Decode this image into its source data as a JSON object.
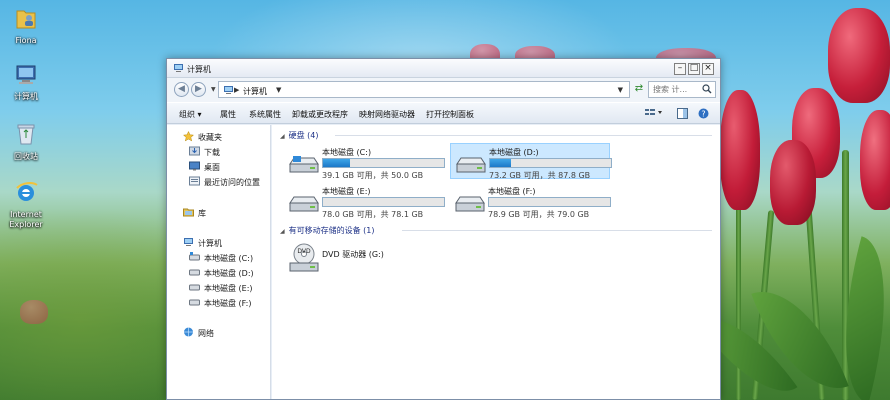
{
  "desktop": {
    "icons": [
      {
        "label": "Fiona"
      },
      {
        "label": "计算机"
      },
      {
        "label": "回收站"
      },
      {
        "label": "Internet Explorer"
      }
    ]
  },
  "window": {
    "title": "计算机",
    "address": {
      "crumb": "计算机"
    },
    "search": {
      "placeholder": "搜索 计..."
    },
    "toolbar": {
      "organize": "组织 ▾",
      "properties": "属性",
      "system_properties": "系统属性",
      "uninstall": "卸载或更改程序",
      "map_drive": "映射网络驱动器",
      "control_panel": "打开控制面板"
    },
    "nav": {
      "favorites": "收藏夹",
      "downloads": "下载",
      "desktop": "桌面",
      "recent": "最近访问的位置",
      "libraries": "库",
      "computer": "计算机",
      "drive_c": "本地磁盘 (C:)",
      "drive_d": "本地磁盘 (D:)",
      "drive_e": "本地磁盘 (E:)",
      "drive_f": "本地磁盘 (F:)",
      "network": "网络"
    },
    "groups": {
      "hdd": "硬盘 (4)",
      "removable": "有可移动存储的设备 (1)"
    },
    "drives": [
      {
        "name": "本地磁盘 (C:)",
        "info": "39.1 GB 可用，共 50.0 GB",
        "used_fraction": 0.22
      },
      {
        "name": "本地磁盘 (D:)",
        "info": "73.2 GB 可用，共 87.8 GB",
        "used_fraction": 0.17
      },
      {
        "name": "本地磁盘 (E:)",
        "info": "78.0 GB 可用，共 78.1 GB",
        "used_fraction": 0.0
      },
      {
        "name": "本地磁盘 (F:)",
        "info": "78.9 GB 可用，共 79.0 GB",
        "used_fraction": 0.0
      }
    ],
    "dvd": {
      "name": "DVD 驱动器 (G:)",
      "badge": "DVD"
    }
  }
}
